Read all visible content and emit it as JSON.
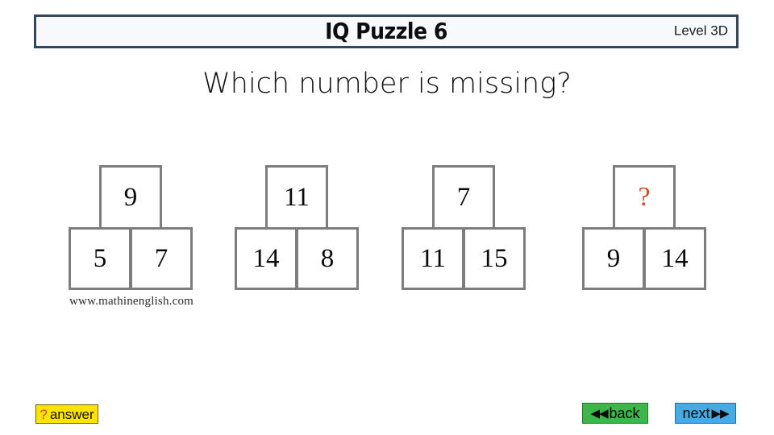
{
  "header": {
    "title": "IQ Puzzle 6",
    "level": "Level 3D"
  },
  "question": "Which number is missing?",
  "watermark": "www.mathinenglish.com",
  "puzzles": [
    {
      "top": "9",
      "bottom_left": "5",
      "bottom_right": "7",
      "unknown": false
    },
    {
      "top": "11",
      "bottom_left": "14",
      "bottom_right": "8",
      "unknown": false
    },
    {
      "top": "7",
      "bottom_left": "11",
      "bottom_right": "15",
      "unknown": false
    },
    {
      "top": "?",
      "bottom_left": "9",
      "bottom_right": "14",
      "unknown": true
    }
  ],
  "footer": {
    "answer_qmark": "?",
    "answer_label": "answer",
    "back_arrows": "◀◀",
    "back_label": "back",
    "next_label": "next",
    "next_arrows": "▶▶"
  },
  "colors": {
    "header_border": "#31465c",
    "cell_border": "#7d7d7d",
    "unknown": "#c4502b",
    "answer_button": "#ffe400",
    "back_button": "#3cb54a",
    "next_button": "#45abe2"
  }
}
